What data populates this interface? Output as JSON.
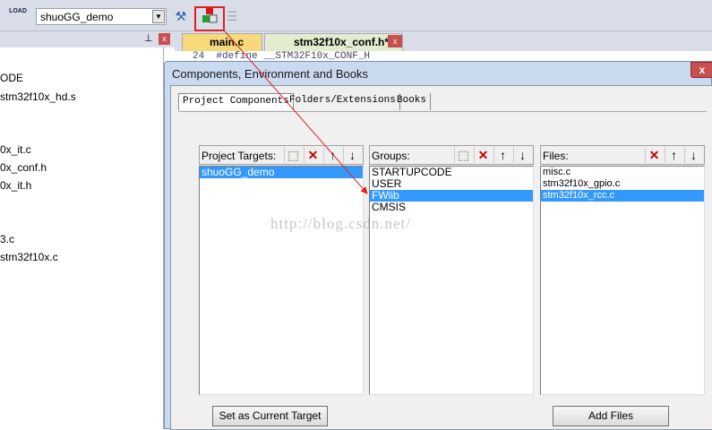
{
  "toolbar": {
    "target": "shuoGG_demo",
    "load_icon": "LOAD"
  },
  "left_panel": {
    "items": [
      "ODE",
      "stm32f10x_hd.s",
      "",
      "0x_it.c",
      "0x_conf.h",
      "0x_it.h",
      "",
      "",
      "3.c",
      "stm32f10x.c"
    ]
  },
  "editor": {
    "tabs": [
      "main.c",
      "stm32f10x_conf.h*"
    ],
    "line_no": "24",
    "code": "#define __STM32F10x_CONF_H"
  },
  "dialog": {
    "title": "Components, Environment and Books",
    "tabs": [
      "Project Components",
      "Folders/Extensions",
      "Books"
    ],
    "targets": {
      "label": "Project Targets:",
      "items": [
        "shuoGG_demo"
      ],
      "selected": 0
    },
    "groups": {
      "label": "Groups:",
      "items": [
        "STARTUPCODE",
        "USER",
        "FWlib",
        "CMSIS"
      ],
      "selected": 2
    },
    "files": {
      "label": "Files:",
      "items": [
        "misc.c",
        "stm32f10x_gpio.c",
        "stm32f10x_rcc.c"
      ],
      "selected": 2
    },
    "set_target_button": "Set as Current Target",
    "add_files_button": "Add Files"
  },
  "watermark": "http://blog.csdn.net/",
  "colors": {
    "selection": "#3399ff",
    "highlight": "#e02020"
  }
}
